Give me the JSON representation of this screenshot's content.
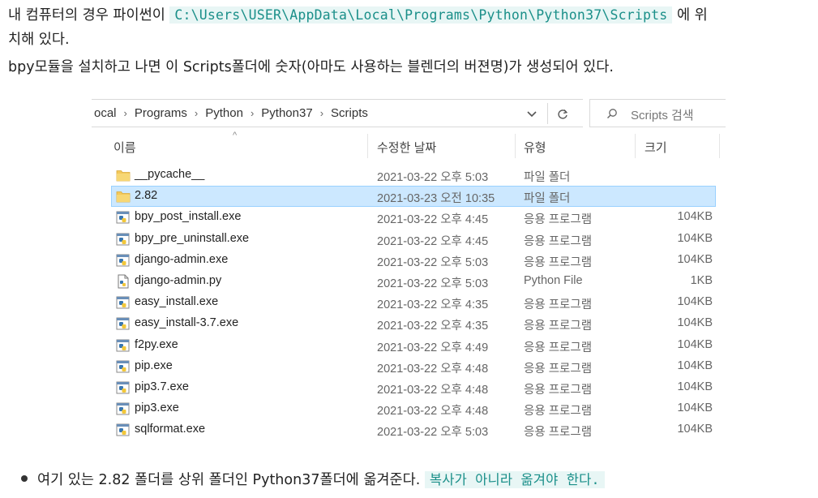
{
  "text": {
    "line1_before": "내 컴퓨터의 경우 파이썬이",
    "line1_code": "C:\\Users\\USER\\AppData\\Local\\Programs\\Python\\Python37\\Scripts",
    "line1_after": "에 위",
    "line2": "치해 있다.",
    "line3": "bpy모듈을 설치하고 나면 이 Scripts폴더에 숫자(아마도 사용하는 블렌더의 버젼명)가 생성되어 있다.",
    "bullet_text": "여기 있는 2.82 폴더를 상위 폴더인 Python37폴더에 옮겨준다.",
    "bullet_code": "복사가 아니라 옮겨야 한다."
  },
  "explorer": {
    "breadcrumbs": [
      "Local",
      "Programs",
      "Python",
      "Python37",
      "Scripts"
    ],
    "breadcrumb_first_visible": "ocal",
    "search_placeholder": "Scripts 검색",
    "columns": {
      "name": "이름",
      "date": "수정한 날짜",
      "type": "유형",
      "size": "크기"
    },
    "rows": [
      {
        "name": "__pycache__",
        "date": "2021-03-22 오후 5:03",
        "type": "파일 폴더",
        "size": "",
        "icon": "folder-icon"
      },
      {
        "name": "2.82",
        "date": "2021-03-23 오전 10:35",
        "type": "파일 폴더",
        "size": "",
        "icon": "folder-icon",
        "selected": true
      },
      {
        "name": "bpy_post_install.exe",
        "date": "2021-03-22 오후 4:45",
        "type": "응용 프로그램",
        "size": "104KB",
        "icon": "python-exe-icon"
      },
      {
        "name": "bpy_pre_uninstall.exe",
        "date": "2021-03-22 오후 4:45",
        "type": "응용 프로그램",
        "size": "104KB",
        "icon": "python-exe-icon"
      },
      {
        "name": "django-admin.exe",
        "date": "2021-03-22 오후 5:03",
        "type": "응용 프로그램",
        "size": "104KB",
        "icon": "python-exe-icon"
      },
      {
        "name": "django-admin.py",
        "date": "2021-03-22 오후 5:03",
        "type": "Python File",
        "size": "1KB",
        "icon": "python-file-icon"
      },
      {
        "name": "easy_install.exe",
        "date": "2021-03-22 오후 4:35",
        "type": "응용 프로그램",
        "size": "104KB",
        "icon": "python-exe-icon"
      },
      {
        "name": "easy_install-3.7.exe",
        "date": "2021-03-22 오후 4:35",
        "type": "응용 프로그램",
        "size": "104KB",
        "icon": "python-exe-icon"
      },
      {
        "name": "f2py.exe",
        "date": "2021-03-22 오후 4:49",
        "type": "응용 프로그램",
        "size": "104KB",
        "icon": "python-exe-icon"
      },
      {
        "name": "pip.exe",
        "date": "2021-03-22 오후 4:48",
        "type": "응용 프로그램",
        "size": "104KB",
        "icon": "python-exe-icon"
      },
      {
        "name": "pip3.7.exe",
        "date": "2021-03-22 오후 4:48",
        "type": "응용 프로그램",
        "size": "104KB",
        "icon": "python-exe-icon"
      },
      {
        "name": "pip3.exe",
        "date": "2021-03-22 오후 4:48",
        "type": "응용 프로그램",
        "size": "104KB",
        "icon": "python-exe-icon"
      },
      {
        "name": "sqlformat.exe",
        "date": "2021-03-22 오후 5:03",
        "type": "응용 프로그램",
        "size": "104KB",
        "icon": "python-exe-icon"
      }
    ]
  },
  "colors": {
    "code_bg": "#e8f6f5",
    "code_fg": "#1a8f89",
    "selection_bg": "#cce8ff",
    "selection_border": "#99d1ff",
    "folder": "#f3c85a"
  }
}
